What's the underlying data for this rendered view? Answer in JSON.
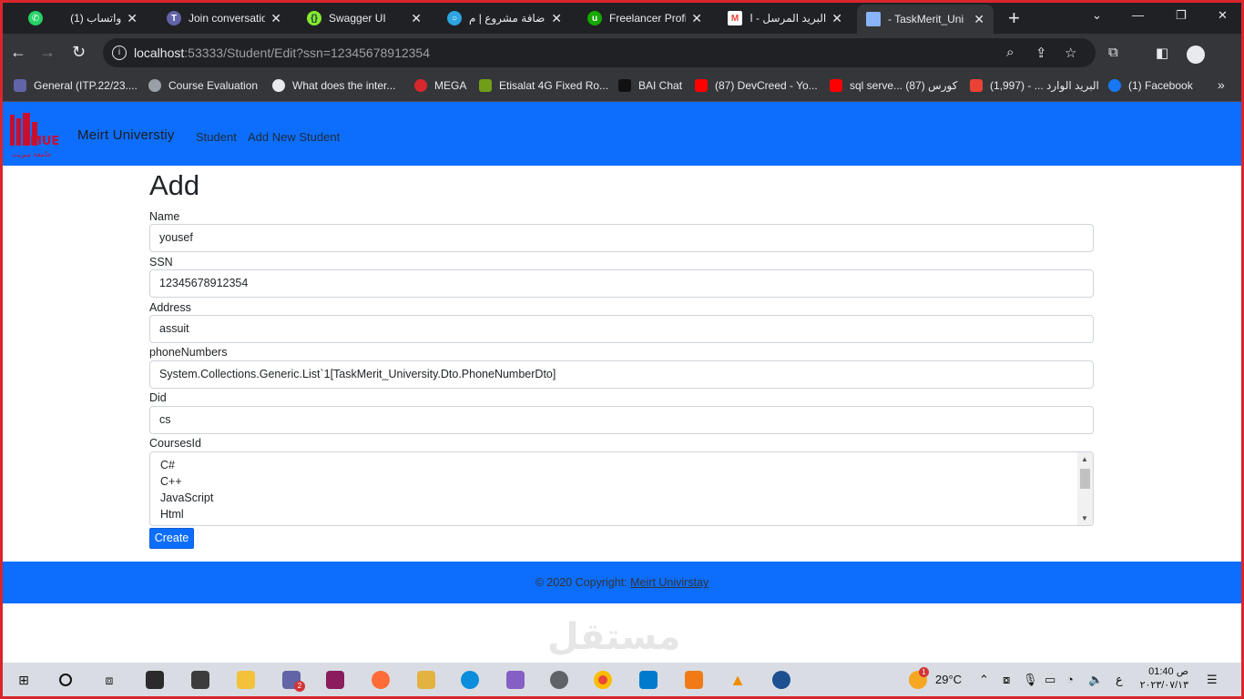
{
  "tabs": [
    {
      "title": "(1) واتساب",
      "icon": "whatsapp-icon",
      "color": "#25d366"
    },
    {
      "title": "Join conversatio",
      "icon": "teams-icon",
      "color": "#6264a7"
    },
    {
      "title": "Swagger UI",
      "icon": "swagger-icon",
      "color": "#85ea2d"
    },
    {
      "title": "إضافة مشروع | م",
      "icon": "mostaql-icon",
      "color": "#2ca5e0"
    },
    {
      "title": "Freelancer Profi",
      "icon": "upwork-icon",
      "color": "#14a800"
    },
    {
      "title": "البريد المرسل - ا",
      "icon": "gmail-icon",
      "color": "#ea4335"
    },
    {
      "title": "- TaskMerit_Uni",
      "icon": "document-icon",
      "color": "#8ab4f8"
    }
  ],
  "address_bar": {
    "host": "localhost",
    "rest": ":53333/Student/Edit?ssn=12345678912354"
  },
  "bookmarks": [
    {
      "label": "General (ITP.22/23....",
      "icon": "teams-icon",
      "color": "#6264a7"
    },
    {
      "label": "Course Evaluation",
      "icon": "globe-icon",
      "color": "#9aa0a6"
    },
    {
      "label": "What does the inter...",
      "icon": "openai-icon",
      "color": "#e8eaed"
    },
    {
      "label": "MEGA",
      "icon": "mega-icon",
      "color": "#d9272e"
    },
    {
      "label": "Etisalat 4G Fixed Ro...",
      "icon": "etisalat-icon",
      "color": "#719e19"
    },
    {
      "label": "BAI Chat",
      "icon": "bai-icon",
      "color": "#111111"
    },
    {
      "label": "(87) DevCreed - Yo...",
      "icon": "youtube-icon",
      "color": "#ff0000"
    },
    {
      "label": "sql serve... كورس (87)",
      "icon": "youtube-icon",
      "color": "#ff0000"
    },
    {
      "label": "البريد الوارد ... - (1,997)",
      "icon": "gmail-icon",
      "color": "#ea4335"
    },
    {
      "label": "(1) Facebook",
      "icon": "facebook-icon",
      "color": "#1877f2"
    }
  ],
  "navbar": {
    "brand": "Meirt Universtiy",
    "links": [
      "Student",
      "Add New Student"
    ],
    "logo_text": "MUE",
    "logo_subtitle": "جامعة ميريت"
  },
  "form": {
    "heading": "Add",
    "fields": [
      {
        "label": "Name",
        "value": "yousef"
      },
      {
        "label": "SSN",
        "value": "12345678912354"
      },
      {
        "label": "Address",
        "value": "assuit"
      },
      {
        "label": "phoneNumbers",
        "value": "System.Collections.Generic.List`1[TaskMerit_University.Dto.PhoneNumberDto]"
      },
      {
        "label": "Did",
        "value": "cs"
      }
    ],
    "courses_label": "CoursesId",
    "courses": [
      "C#",
      "C++",
      "JavaScript",
      "Html"
    ],
    "submit_label": "Create"
  },
  "footer": {
    "text": "© 2020 Copyright:",
    "link": "Meirt Univirstay"
  },
  "watermark": "مستقل",
  "taskbar": {
    "temperature": "29°C",
    "time": "01:40 ص",
    "date": "٢٠٢٣/٠٧/١٣",
    "teams_badge": "2",
    "weather_badge": "1",
    "lang": "ع"
  },
  "colors": {
    "primary": "#0d6efd",
    "chrome_dark": "#202124",
    "chrome_toolbar": "#35363a"
  }
}
